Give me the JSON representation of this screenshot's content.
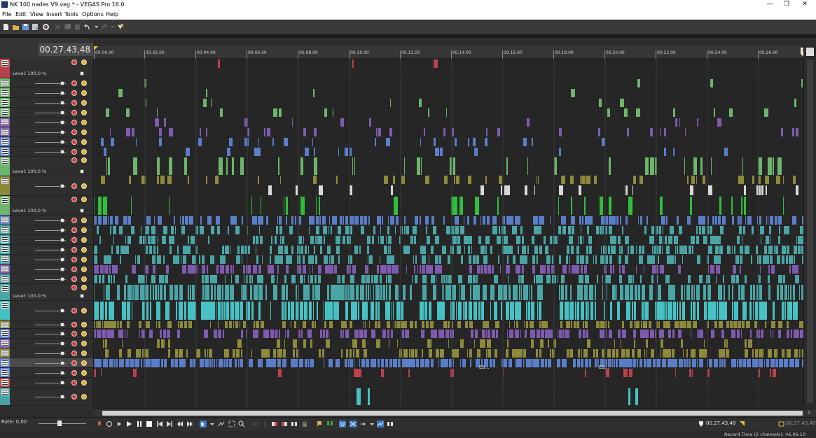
{
  "window": {
    "title": "NK 100 nades V9.veg * - VEGAS Pro 16.0",
    "minimize_glyph": "—",
    "maximize_glyph": "❐",
    "close_glyph": "✕"
  },
  "menu": {
    "items": [
      "File",
      "Edit",
      "View",
      "Insert",
      "Tools",
      "Options",
      "Help"
    ]
  },
  "timeline": {
    "cursor_timecode": "00.27.43,48",
    "ruler_ticks": [
      "00.00.00",
      "00.02.00",
      "00.04.00",
      "00.06.00",
      "00.08.00",
      "00.10.00",
      "00.12.00",
      "00.14.00",
      "00.16.00",
      "00.18.00",
      "00.20.00",
      "00.22.00",
      "00.24.00",
      "00.26.00"
    ]
  },
  "tracks": {
    "level_labels": [
      "Level: 100,0 %",
      "Level: 100,0 %",
      "Level: 100,0 %",
      "Level: 100,0 %"
    ],
    "colors": {
      "red": "#b8434c",
      "green": "#6db56d",
      "olive": "#8d8a3a",
      "purple": "#7e5bb0",
      "blue": "#5b7ec9",
      "teal": "#4aa6a6",
      "cyan": "#47c1c3",
      "bright_green": "#2fbf3d"
    },
    "clip_labels": [
      "ES...",
      "ES..."
    ]
  },
  "transport": {
    "rate": "Rate: 0,00",
    "selection_end": "00.27.43,48",
    "length": "00.27.43,48"
  },
  "status": {
    "record_time": "Record Time (2 channels): 46.06.10"
  }
}
